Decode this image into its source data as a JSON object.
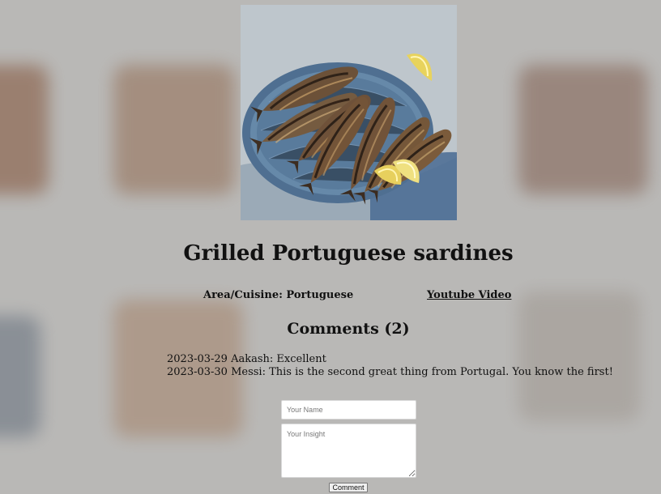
{
  "recipe": {
    "title": "Grilled Portuguese sardines",
    "area_label": "Area/Cuisine: Portuguese",
    "video_link": "Youtube Video"
  },
  "comments": {
    "heading": "Comments (2)",
    "items": [
      "2023-03-29 Aakash: Excellent",
      "2023-03-30 Messi: This is the second great thing from Portugal. You know the first!"
    ]
  },
  "form": {
    "name_placeholder": "Your Name",
    "insight_placeholder": "Your Insight",
    "submit_label": "Comment"
  }
}
